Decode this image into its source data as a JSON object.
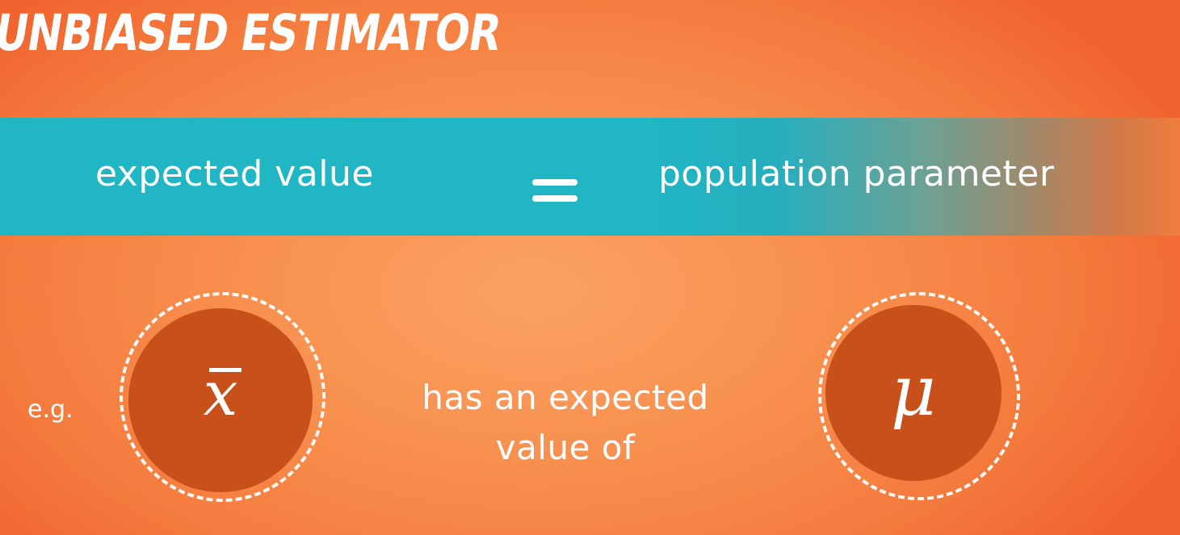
{
  "title": "UNBIASED ESTIMATOR",
  "definition": {
    "left": "expected value",
    "operator": "=",
    "right": "population parameter"
  },
  "example": {
    "prefix": "e.g.",
    "estimator_symbol": "x",
    "estimator_name": "x-bar",
    "relation_line1": "has an expected",
    "relation_line2": "value of",
    "parameter_symbol": "μ",
    "parameter_name": "mu"
  },
  "colors": {
    "background": "#f47a3c",
    "band": "#20b6c4",
    "circle_fill": "#c8501b",
    "text": "#ffffff"
  }
}
